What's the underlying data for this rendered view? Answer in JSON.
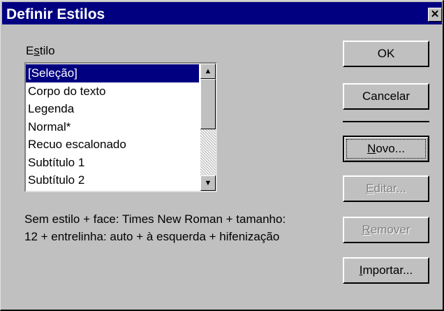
{
  "window": {
    "title": "Definir Estilos",
    "close_symbol": "✕"
  },
  "style_list": {
    "label": "Estilo",
    "label_mnemonic": "s",
    "items": [
      {
        "label": "[Seleção]",
        "selected": true
      },
      {
        "label": "Corpo do texto",
        "selected": false
      },
      {
        "label": "Legenda",
        "selected": false
      },
      {
        "label": "Normal*",
        "selected": false
      },
      {
        "label": "Recuo escalonado",
        "selected": false
      },
      {
        "label": "Subtítulo 1",
        "selected": false
      },
      {
        "label": "Subtítulo 2",
        "selected": false
      }
    ],
    "scroll_up_symbol": "▲",
    "scroll_down_symbol": "▼"
  },
  "description": "Sem estilo + face: Times New Roman + tamanho: 12 + entrelinha: auto + à esquerda + hifenização",
  "buttons": {
    "ok": {
      "label": "OK",
      "enabled": true
    },
    "cancel": {
      "label": "Cancelar",
      "enabled": true
    },
    "new": {
      "label": "Novo...",
      "mnemonic": "N",
      "enabled": true,
      "focused": true
    },
    "edit": {
      "label": "Editar...",
      "mnemonic": "E",
      "enabled": false
    },
    "remove": {
      "label": "Remover",
      "mnemonic": "R",
      "enabled": false
    },
    "import": {
      "label": "Importar...",
      "mnemonic": "I",
      "enabled": true
    }
  },
  "colors": {
    "face": "#c0c0c0",
    "title_bar": "#000080",
    "selection": "#000080",
    "disabled_text": "#808080"
  }
}
